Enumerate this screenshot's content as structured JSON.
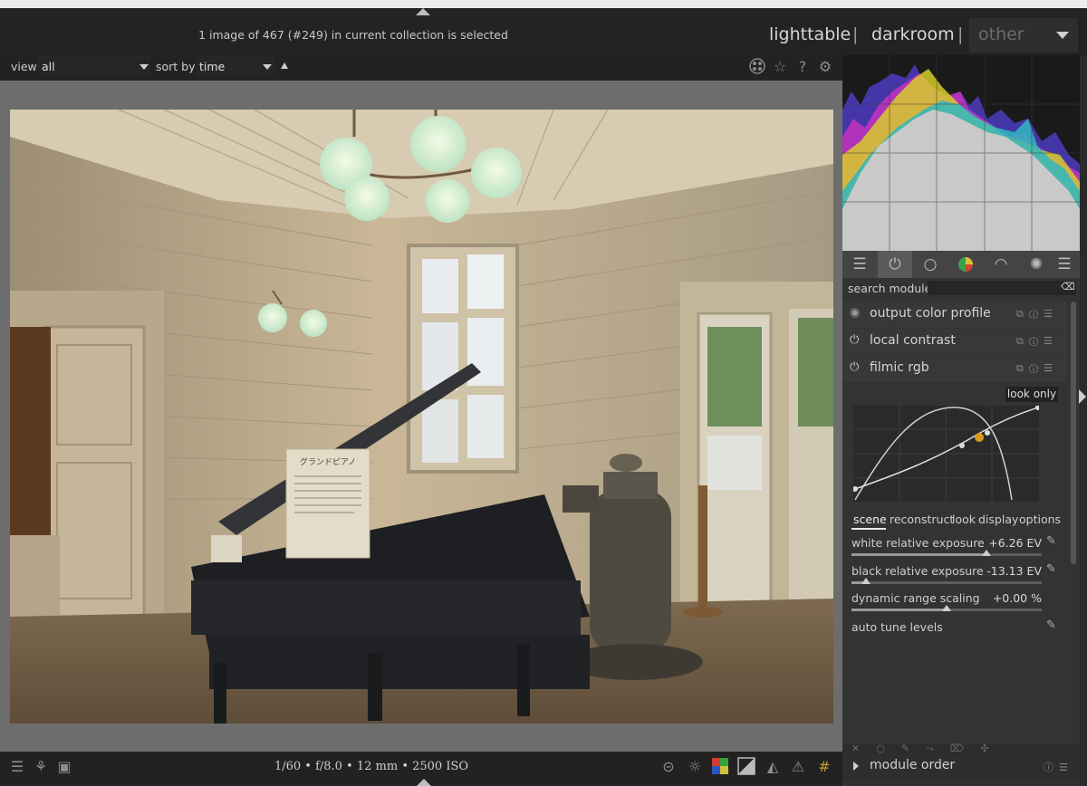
{
  "header": {
    "status_text": "1 image of 467 (#249) in current collection is selected",
    "views": [
      "lighttable",
      "darkroom",
      "other"
    ],
    "separator": "|"
  },
  "filter_bar": {
    "view_label": "view",
    "view_value": "all",
    "sort_label": "sort by",
    "sort_value": "time",
    "icons": [
      "grouping-icon",
      "star-icon",
      "help-icon",
      "settings-icon"
    ]
  },
  "image_info": {
    "exif": "1/60 • f/8.0 • 12 mm • 2500 ISO",
    "sign_text": "グランドピアノ"
  },
  "module_search": {
    "label": "search module",
    "placeholder": ""
  },
  "module_tabs": [
    "presets-icon",
    "power-icon",
    "base-icon",
    "color-icon",
    "correct-icon",
    "effect-icon"
  ],
  "modules": [
    {
      "name": "output color profile",
      "state_icon": "radio-icon"
    },
    {
      "name": "local contrast",
      "state_icon": "power-icon"
    },
    {
      "name": "filmic rgb",
      "state_icon": "power-icon"
    }
  ],
  "filmic": {
    "graph_mode": "look only",
    "tabs": [
      "scene",
      "reconstruct",
      "look",
      "display",
      "options"
    ],
    "active_tab": "scene",
    "sliders": [
      {
        "label": "white relative exposure",
        "value": "+6.26 EV",
        "position": 0.74
      },
      {
        "label": "black relative exposure",
        "value": "-13.13 EV",
        "position": 0.08
      },
      {
        "label": "dynamic range scaling",
        "value": "+0.00 %",
        "position": 0.5
      }
    ],
    "auto_tune_label": "auto tune levels"
  },
  "bottom_panel": {
    "module_order_label": "module order"
  }
}
